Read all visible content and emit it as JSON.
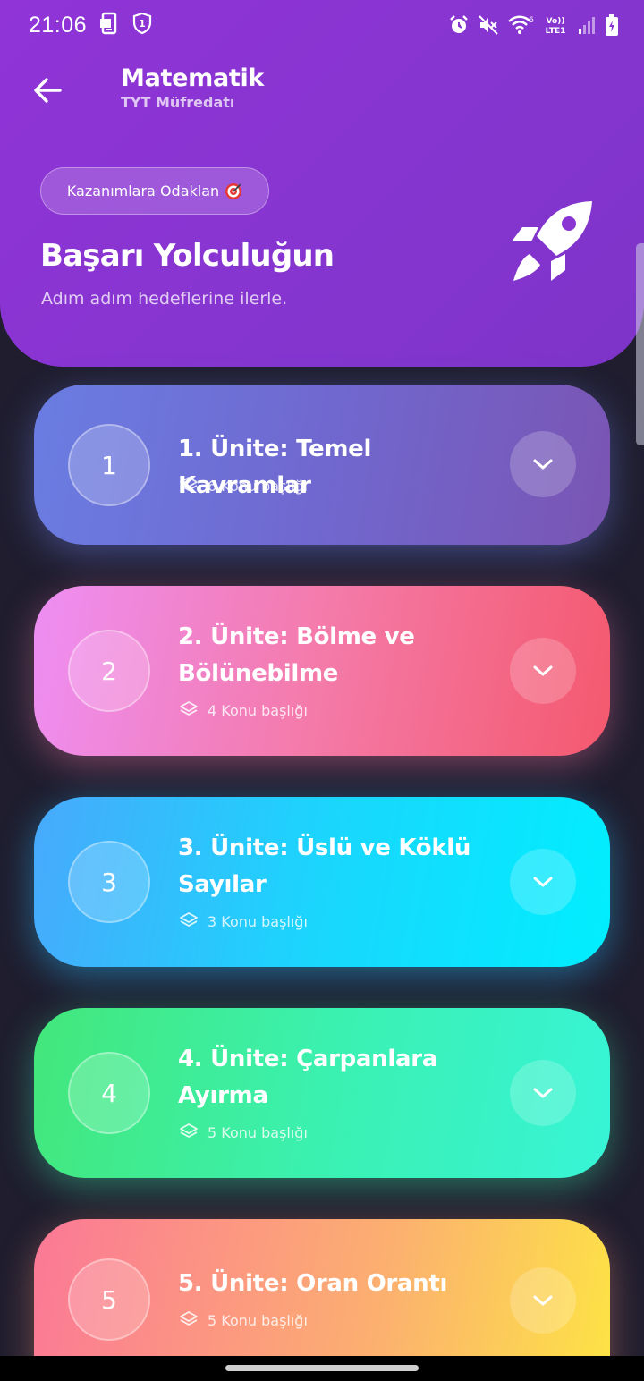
{
  "status_bar": {
    "time": "21:06",
    "left_icons": [
      "notification-app-icon",
      "vpn-shield-icon"
    ],
    "right_icons": [
      "alarm-icon",
      "mute-icon",
      "wifi-icon",
      "volte-icon",
      "signal-icon",
      "battery-charging-icon"
    ],
    "volte_label": "Vo)) LTE1"
  },
  "header": {
    "title": "Matematik",
    "subtitle": "TYT Müfredatı",
    "back_icon": "arrow-left-icon"
  },
  "hero": {
    "chip_label": "Kazanımlara Odaklan",
    "chip_icon": "target-icon",
    "title": "Başarı Yolculuğun",
    "subtitle": "Adım adım hedeflerine ilerle.",
    "illustration_icon": "rocket-icon"
  },
  "units": [
    {
      "number": "1",
      "title": "1. Ünite: Temel Kavramlar",
      "meta": "6 Konu başlığı"
    },
    {
      "number": "2",
      "title": "2. Ünite: Bölme ve Bölünebilme",
      "meta": "4 Konu başlığı"
    },
    {
      "number": "3",
      "title": "3. Ünite: Üslü ve Köklü Sayılar",
      "meta": "3 Konu başlığı"
    },
    {
      "number": "4",
      "title": "4. Ünite: Çarpanlara Ayırma",
      "meta": "5 Konu başlığı"
    },
    {
      "number": "5",
      "title": "5. Ünite: Oran Orantı",
      "meta": "5 Konu başlığı"
    }
  ],
  "colors": {
    "header_bg": "#8a35d2",
    "page_bg": "#1f1d2e",
    "unit_1": "#6a7de2",
    "unit_2": "#f47aa8",
    "unit_3": "#1ad6fd",
    "unit_4": "#3bf1b0",
    "unit_5": "#fcb070"
  }
}
